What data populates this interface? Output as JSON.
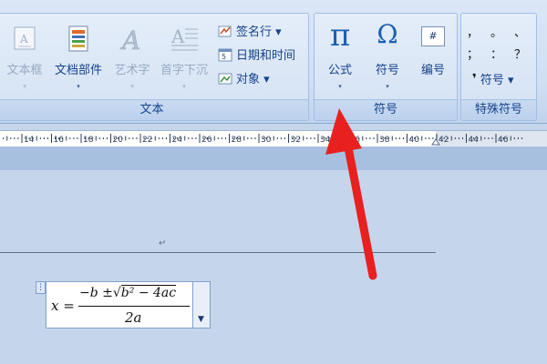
{
  "ribbon": {
    "text_group": {
      "label": "文本",
      "buttons": [
        {
          "label": "文本框",
          "icon": "text-box-icon",
          "enabled": false
        },
        {
          "label": "文档部件",
          "icon": "document-parts-icon",
          "enabled": true
        },
        {
          "label": "艺术字",
          "icon": "wordart-icon",
          "enabled": false
        },
        {
          "label": "首字下沉",
          "icon": "drop-cap-icon",
          "enabled": false
        }
      ],
      "small_buttons": [
        {
          "label": "签名行 ▾",
          "icon": "signature-line-icon"
        },
        {
          "label": "日期和时间",
          "icon": "date-time-icon"
        },
        {
          "label": "对象 ▾",
          "icon": "object-icon"
        }
      ]
    },
    "symbols_group": {
      "label": "符号",
      "buttons": [
        {
          "label": "公式",
          "glyph": "π",
          "icon": "pi-equation-icon"
        },
        {
          "label": "符号",
          "glyph": "Ω",
          "icon": "omega-symbol-icon"
        },
        {
          "label": "编号",
          "glyph": "#",
          "icon": "number-icon"
        }
      ]
    },
    "special_group": {
      "label": "特殊符号",
      "glyphs": [
        "，",
        "。",
        "、",
        "；",
        "：",
        "？"
      ],
      "button_label": "符号 ▾"
    },
    "dropdown_arrow": "▾"
  },
  "ruler": {
    "ticks": [
      "14",
      "16",
      "18",
      "20",
      "22",
      "24",
      "26",
      "28",
      "30",
      "32",
      "34",
      "36",
      "38",
      "40",
      "42",
      "44",
      "46"
    ]
  },
  "document": {
    "paragraph_mark": "↵",
    "equation": {
      "lhs": "x =",
      "numerator": "−b ± √(b² − 4ac)",
      "numerator_parts": {
        "minus_b": "−b ±",
        "radicand": "b² − 4ac"
      },
      "denominator": "2a"
    }
  },
  "colors": {
    "arrow": "#e8201f",
    "ribbon_text": "#15428b",
    "accent": "#1d5fb1"
  }
}
